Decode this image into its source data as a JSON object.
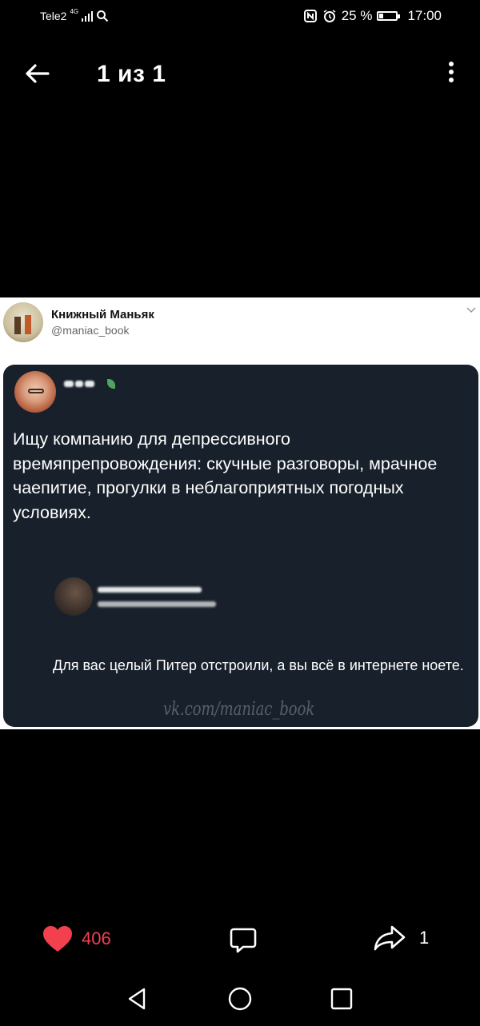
{
  "status_bar": {
    "carrier": "Tele2",
    "network": "4G",
    "battery_percent": "25 %",
    "battery_level": 0.25,
    "time": "17:00",
    "icons": [
      "signal-icon",
      "search-icon",
      "nfc-icon",
      "alarm-icon",
      "battery-icon"
    ]
  },
  "header": {
    "title": "1 из 1",
    "icons": [
      "back-arrow-icon",
      "more-vert-icon"
    ]
  },
  "post": {
    "author_name": "Книжный Маньяк",
    "author_handle": "@maniac_book",
    "tweet_text": "Ищу компанию для депрессивного времяпрепровождения: скучные разговоры, мрачное чаепитие, прогулки в неблагоприятных погодных условиях.",
    "reply_text": "Для вас целый Питер отстроили, а вы всё в интернете ноете.",
    "watermark": "vk.com/maniac_book"
  },
  "actions": {
    "likes": "406",
    "shares": "1",
    "like_color": "#f2404f",
    "icons": [
      "heart-icon",
      "comment-icon",
      "share-icon"
    ]
  },
  "nav_bar": {
    "icons": [
      "back-triangle-icon",
      "home-circle-icon",
      "recents-square-icon"
    ]
  },
  "colors": {
    "background": "#000000",
    "card_background": "#18202b",
    "post_background": "#ffffff"
  }
}
